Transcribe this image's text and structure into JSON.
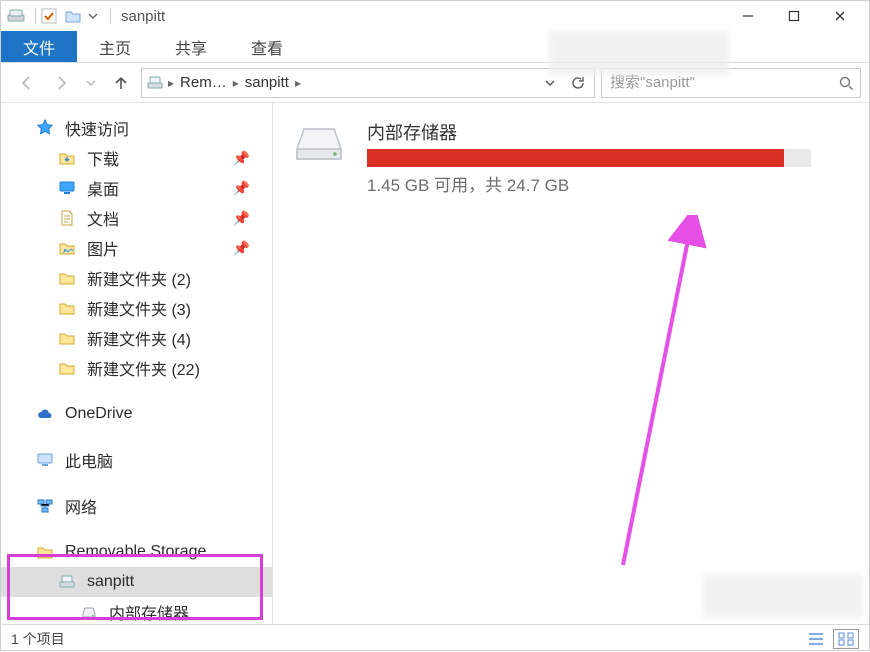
{
  "titlebar": {
    "title": "sanpitt"
  },
  "ribbon": {
    "tabs": [
      {
        "label": "文件",
        "active": true
      },
      {
        "label": "主页"
      },
      {
        "label": "共享"
      },
      {
        "label": "查看"
      }
    ]
  },
  "address": {
    "crumbs": [
      "Rem…",
      "sanpitt"
    ]
  },
  "search": {
    "placeholder": "搜索\"sanpitt\""
  },
  "sidebar": {
    "quick_access": {
      "label": "快速访问"
    },
    "qa_items": [
      {
        "label": "下载",
        "pinned": true,
        "icon": "downloads"
      },
      {
        "label": "桌面",
        "pinned": true,
        "icon": "desktop"
      },
      {
        "label": "文档",
        "pinned": true,
        "icon": "documents"
      },
      {
        "label": "图片",
        "pinned": true,
        "icon": "pictures"
      },
      {
        "label": "新建文件夹 (2)",
        "pinned": false,
        "icon": "folder"
      },
      {
        "label": "新建文件夹 (3)",
        "pinned": false,
        "icon": "folder"
      },
      {
        "label": "新建文件夹 (4)",
        "pinned": false,
        "icon": "folder"
      },
      {
        "label": "新建文件夹 (22)",
        "pinned": false,
        "icon": "folder"
      }
    ],
    "onedrive": {
      "label": "OneDrive"
    },
    "thispc": {
      "label": "此电脑"
    },
    "network": {
      "label": "网络"
    },
    "removable": {
      "label": "Removable Storage"
    },
    "sanpitt": {
      "label": "sanpitt"
    },
    "internal": {
      "label": "内部存储器"
    }
  },
  "content": {
    "storage": {
      "title": "内部存储器",
      "subtitle": "1.45 GB 可用，共 24.7 GB",
      "fill_percent": 94
    }
  },
  "statusbar": {
    "count": "1 个项目"
  }
}
